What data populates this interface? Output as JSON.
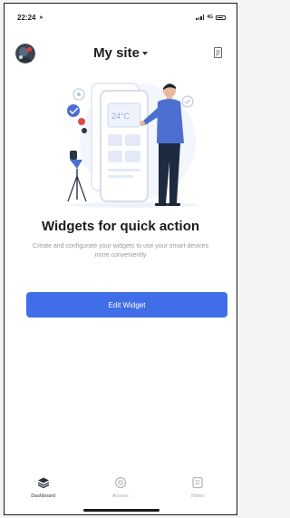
{
  "status_bar": {
    "time": "22:24",
    "network": "4G"
  },
  "header": {
    "title": "My site",
    "avatar_icon": "avatar-icon",
    "menu_icon": "document-icon"
  },
  "illustration": {
    "phone_screen_value": "24°C"
  },
  "empty_state": {
    "headline": "Widgets for quick action",
    "description": "Create and configurate your widgets to use your smart devices more conveniently",
    "button_label": "Edit Widget"
  },
  "tabbar": {
    "items": [
      {
        "label": "Dashboard",
        "icon": "dashboard-icon",
        "active": true
      },
      {
        "label": "Access",
        "icon": "access-icon",
        "active": false
      },
      {
        "label": "Notes",
        "icon": "notes-icon",
        "active": false
      }
    ]
  },
  "colors": {
    "accent": "#3f6ee8",
    "text": "#1b1b1b",
    "muted": "#9a9a9a"
  }
}
